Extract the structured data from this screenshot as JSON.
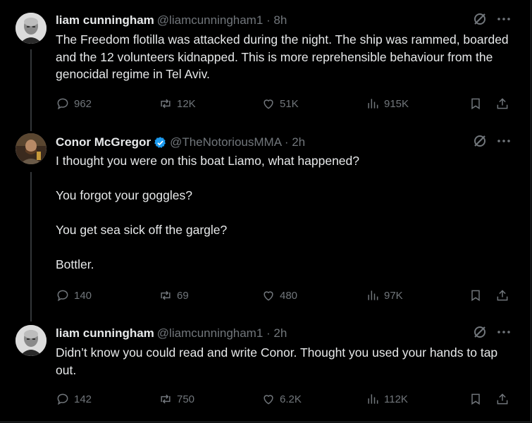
{
  "tweets": [
    {
      "name": "liam cunningham",
      "handle": "@liamcunningham1 · 8h",
      "text": "The Freedom flotilla was attacked during the night. The ship was rammed, boarded and the 12 volunteers kidnapped. This is more reprehensible behaviour from the genocidal regime in Tel Aviv.",
      "replies": "962",
      "reposts": "12K",
      "likes": "51K",
      "views": "915K"
    },
    {
      "name": "Conor McGregor",
      "handle": "@TheNotoriousMMA · 2h",
      "text": "I thought you were on this boat Liamo, what happened?\n\nYou forgot your goggles?\n\nYou get sea sick off the gargle?\n\nBottler.",
      "replies": "140",
      "reposts": "69",
      "likes": "480",
      "views": "97K"
    },
    {
      "name": "liam cunningham",
      "handle": "@liamcunningham1 · 2h",
      "text": "Didn’t know you could read and write Conor. Thought you used your hands to tap out.",
      "replies": "142",
      "reposts": "750",
      "likes": "6.2K",
      "views": "112K"
    }
  ],
  "colors": {
    "background": "#000000",
    "text": "#e7e9ea",
    "muted": "#71767b",
    "verified": "#1d9bf0",
    "thread_line": "#333639"
  }
}
